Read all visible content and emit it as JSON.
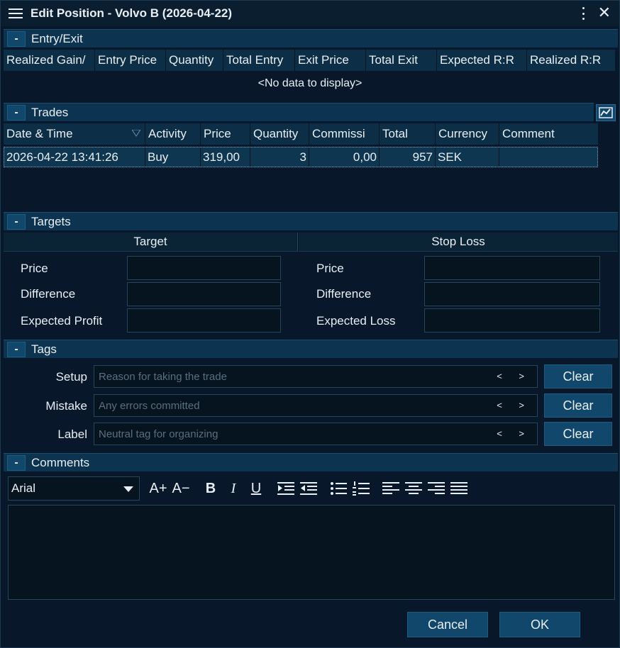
{
  "window": {
    "title": "Edit Position - Volvo B (2026-04-22)"
  },
  "sections": {
    "entry_exit": "Entry/Exit",
    "trades": "Trades",
    "targets": "Targets",
    "tags": "Tags",
    "comments": "Comments",
    "toggle_symbol": "-"
  },
  "entry_exit": {
    "columns": [
      "Realized Gain/",
      "Entry Price",
      "Quantity",
      "Total Entry",
      "Exit Price",
      "Total Exit",
      "Expected R:R",
      "Realized R:R"
    ],
    "empty_text": "<No data to display>"
  },
  "trades": {
    "columns": [
      "Date & Time",
      "Activity",
      "Price",
      "Quantity",
      "Commissi",
      "Total",
      "Currency",
      "Comment"
    ],
    "rows": [
      {
        "datetime": "2026-04-22 13:41:26",
        "activity": "Buy",
        "price": "319,00",
        "quantity": "3",
        "commission": "0,00",
        "total": "957",
        "currency": "SEK",
        "comment": ""
      }
    ]
  },
  "targets": {
    "target_header": "Target",
    "stoploss_header": "Stop Loss",
    "target_labels": [
      "Price",
      "Difference",
      "Expected Profit"
    ],
    "stoploss_labels": [
      "Price",
      "Difference",
      "Expected Loss"
    ]
  },
  "tags": {
    "setup_label": "Setup",
    "setup_placeholder": "Reason for taking the trade",
    "mistake_label": "Mistake",
    "mistake_placeholder": "Any errors committed",
    "label_label": "Label",
    "label_placeholder": "Neutral tag for organizing",
    "arrows": "< >",
    "clear": "Clear"
  },
  "comments": {
    "font": "Arial",
    "grow_font": "A+",
    "shrink_font": "A−",
    "bold": "B",
    "italic": "I",
    "underline": "U"
  },
  "footer": {
    "cancel": "Cancel",
    "ok": "OK"
  }
}
